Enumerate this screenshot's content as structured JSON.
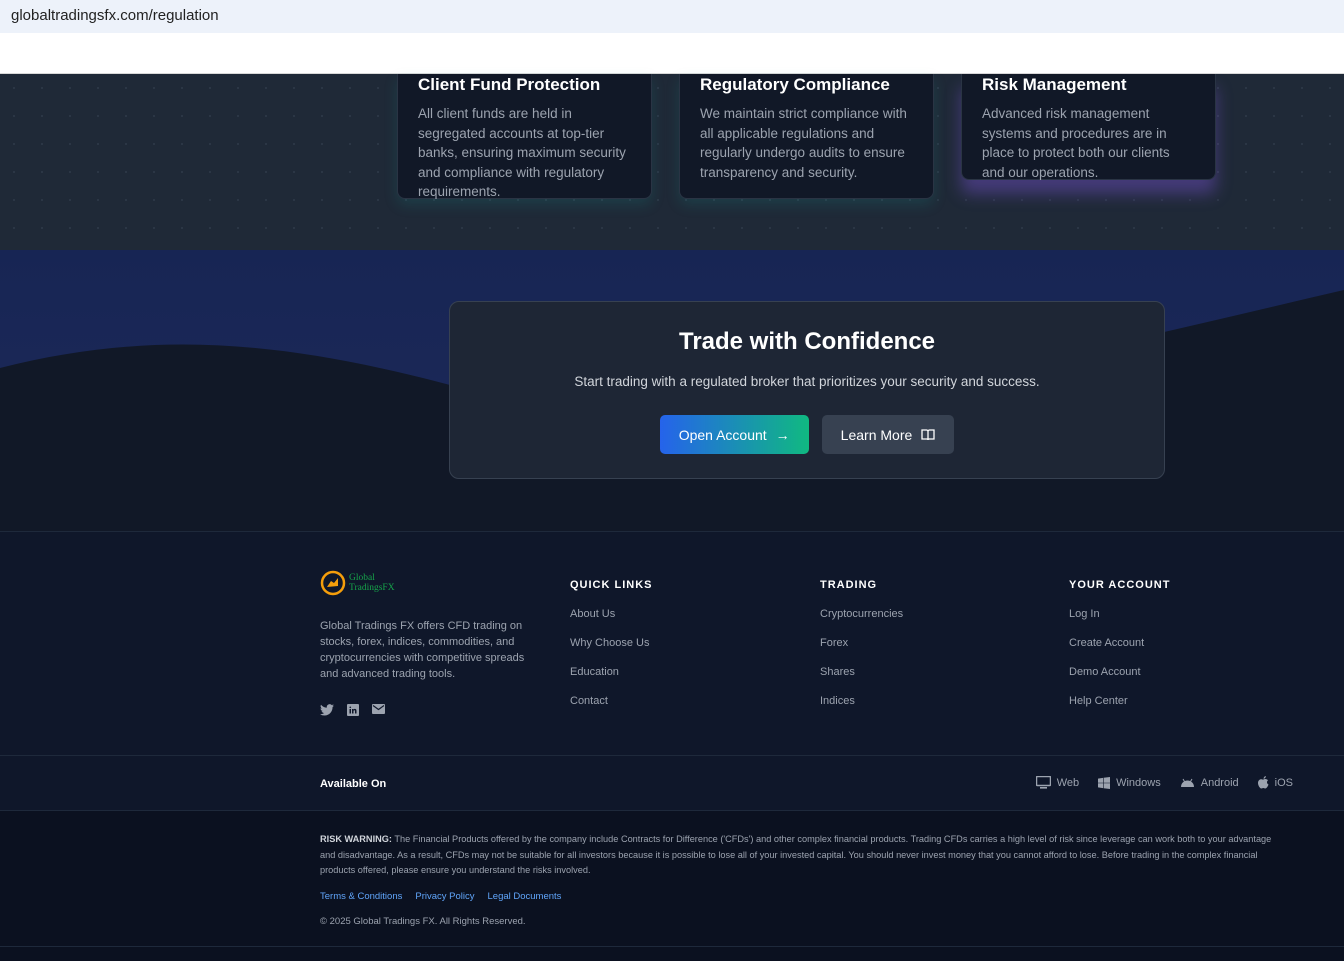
{
  "browser": {
    "url": "globaltradingsfx.com/regulation"
  },
  "cards": [
    {
      "title": "Client Fund Protection",
      "text": "All client funds are held in segregated accounts at top-tier banks, ensuring maximum security and compliance with regulatory requirements."
    },
    {
      "title": "Regulatory Compliance",
      "text": "We maintain strict compliance with all applicable regulations and regularly undergo audits to ensure transparency and security."
    },
    {
      "title": "Risk Management",
      "text": "Advanced risk management systems and procedures are in place to protect both our clients and our operations."
    }
  ],
  "cta": {
    "title": "Trade with Confidence",
    "subtitle": "Start trading with a regulated broker that prioritizes your security and success.",
    "open_account": "Open Account",
    "learn_more": "Learn More"
  },
  "footer": {
    "logo": "Global TradingsFX",
    "description": "Global Tradings FX offers CFD trading on stocks, forex, indices, commodities, and cryptocurrencies with competitive spreads and advanced trading tools.",
    "columns": [
      {
        "title": "QUICK LINKS",
        "links": [
          "About Us",
          "Why Choose Us",
          "Education",
          "Contact"
        ]
      },
      {
        "title": "TRADING",
        "links": [
          "Cryptocurrencies",
          "Forex",
          "Shares",
          "Indices"
        ]
      },
      {
        "title": "YOUR ACCOUNT",
        "links": [
          "Log In",
          "Create Account",
          "Demo Account",
          "Help Center"
        ]
      }
    ],
    "available_on": "Available On",
    "platforms": [
      "Web",
      "Windows",
      "Android",
      "iOS"
    ],
    "risk_label": "RISK WARNING:",
    "risk_text": " The Financial Products offered by the company include Contracts for Difference ('CFDs') and other complex financial products. Trading CFDs carries a high level of risk since leverage can work both to your advantage and disadvantage. As a result, CFDs may not be suitable for all investors because it is possible to lose all of your invested capital. You should never invest money that you cannot afford to lose. Before trading in the complex financial products offered, please ensure you understand the risks involved.",
    "legal_links": [
      "Terms & Conditions",
      "Privacy Policy",
      "Legal Documents"
    ],
    "copyright": "© 2025 Global Tradings FX. All Rights Reserved."
  },
  "colors": {
    "accent_blue": "#2563eb",
    "accent_green": "#10b981",
    "link": "#60a5fa"
  }
}
